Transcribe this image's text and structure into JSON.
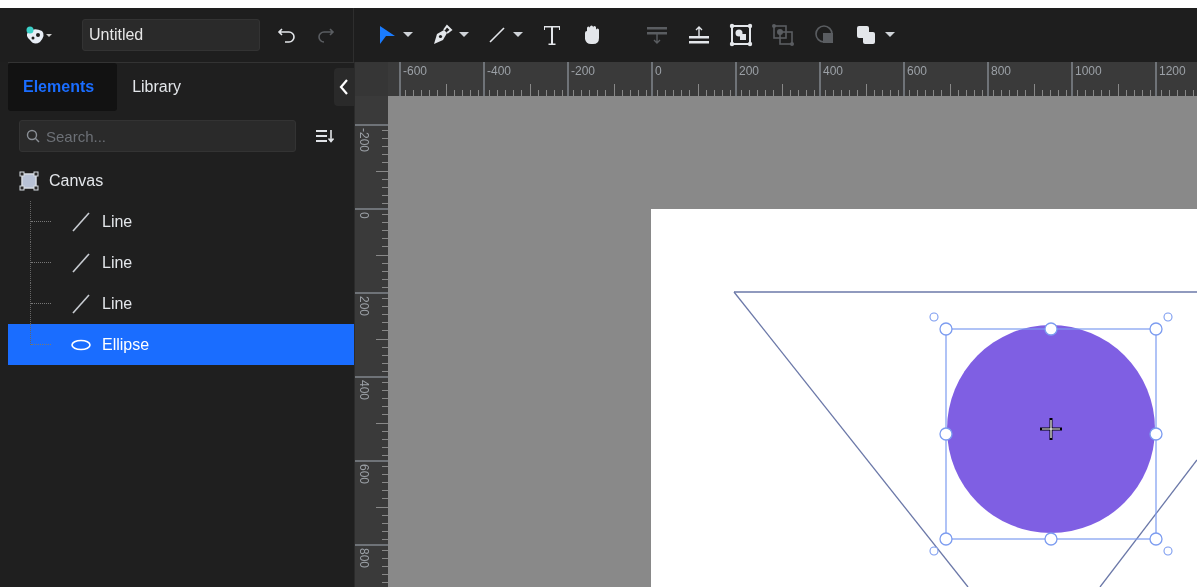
{
  "document": {
    "title": "Untitled"
  },
  "history": [
    {
      "kind": "undo",
      "disabled": false
    },
    {
      "kind": "redo",
      "disabled": true
    }
  ],
  "tools": [
    {
      "kind": "select",
      "selected": true,
      "menu": true
    },
    {
      "kind": "pen",
      "selected": false,
      "menu": true
    },
    {
      "kind": "line",
      "selected": false,
      "menu": true
    },
    {
      "kind": "text",
      "selected": false,
      "menu": false
    },
    {
      "kind": "hand",
      "selected": false,
      "menu": false
    }
  ],
  "arrange": [
    {
      "kind": "align-top",
      "disabled": true
    },
    {
      "kind": "align-bottom",
      "disabled": false
    },
    {
      "kind": "group",
      "disabled": false
    },
    {
      "kind": "ungroup",
      "disabled": true
    },
    {
      "kind": "mask",
      "disabled": true
    },
    {
      "kind": "combine",
      "disabled": false
    }
  ],
  "tabs": [
    {
      "label": "Elements",
      "selected": true
    },
    {
      "label": "Library",
      "selected": false
    }
  ],
  "search": {
    "placeholder": "Search..."
  },
  "tree": {
    "label": "Canvas",
    "kind": "canvas",
    "children": [
      {
        "label": "Line",
        "kind": "line",
        "selected": false
      },
      {
        "label": "Line",
        "kind": "line",
        "selected": false
      },
      {
        "label": "Line",
        "kind": "line",
        "selected": false
      },
      {
        "label": "Ellipse",
        "kind": "ellipse",
        "selected": true
      }
    ]
  },
  "ruler": {
    "horizontal": [
      "-600",
      "-400",
      "-200",
      "0",
      "200",
      "400",
      "600",
      "800",
      "1000",
      "1200"
    ],
    "vertical": [
      "-200",
      "0",
      "200",
      "400",
      "600",
      "800"
    ]
  }
}
